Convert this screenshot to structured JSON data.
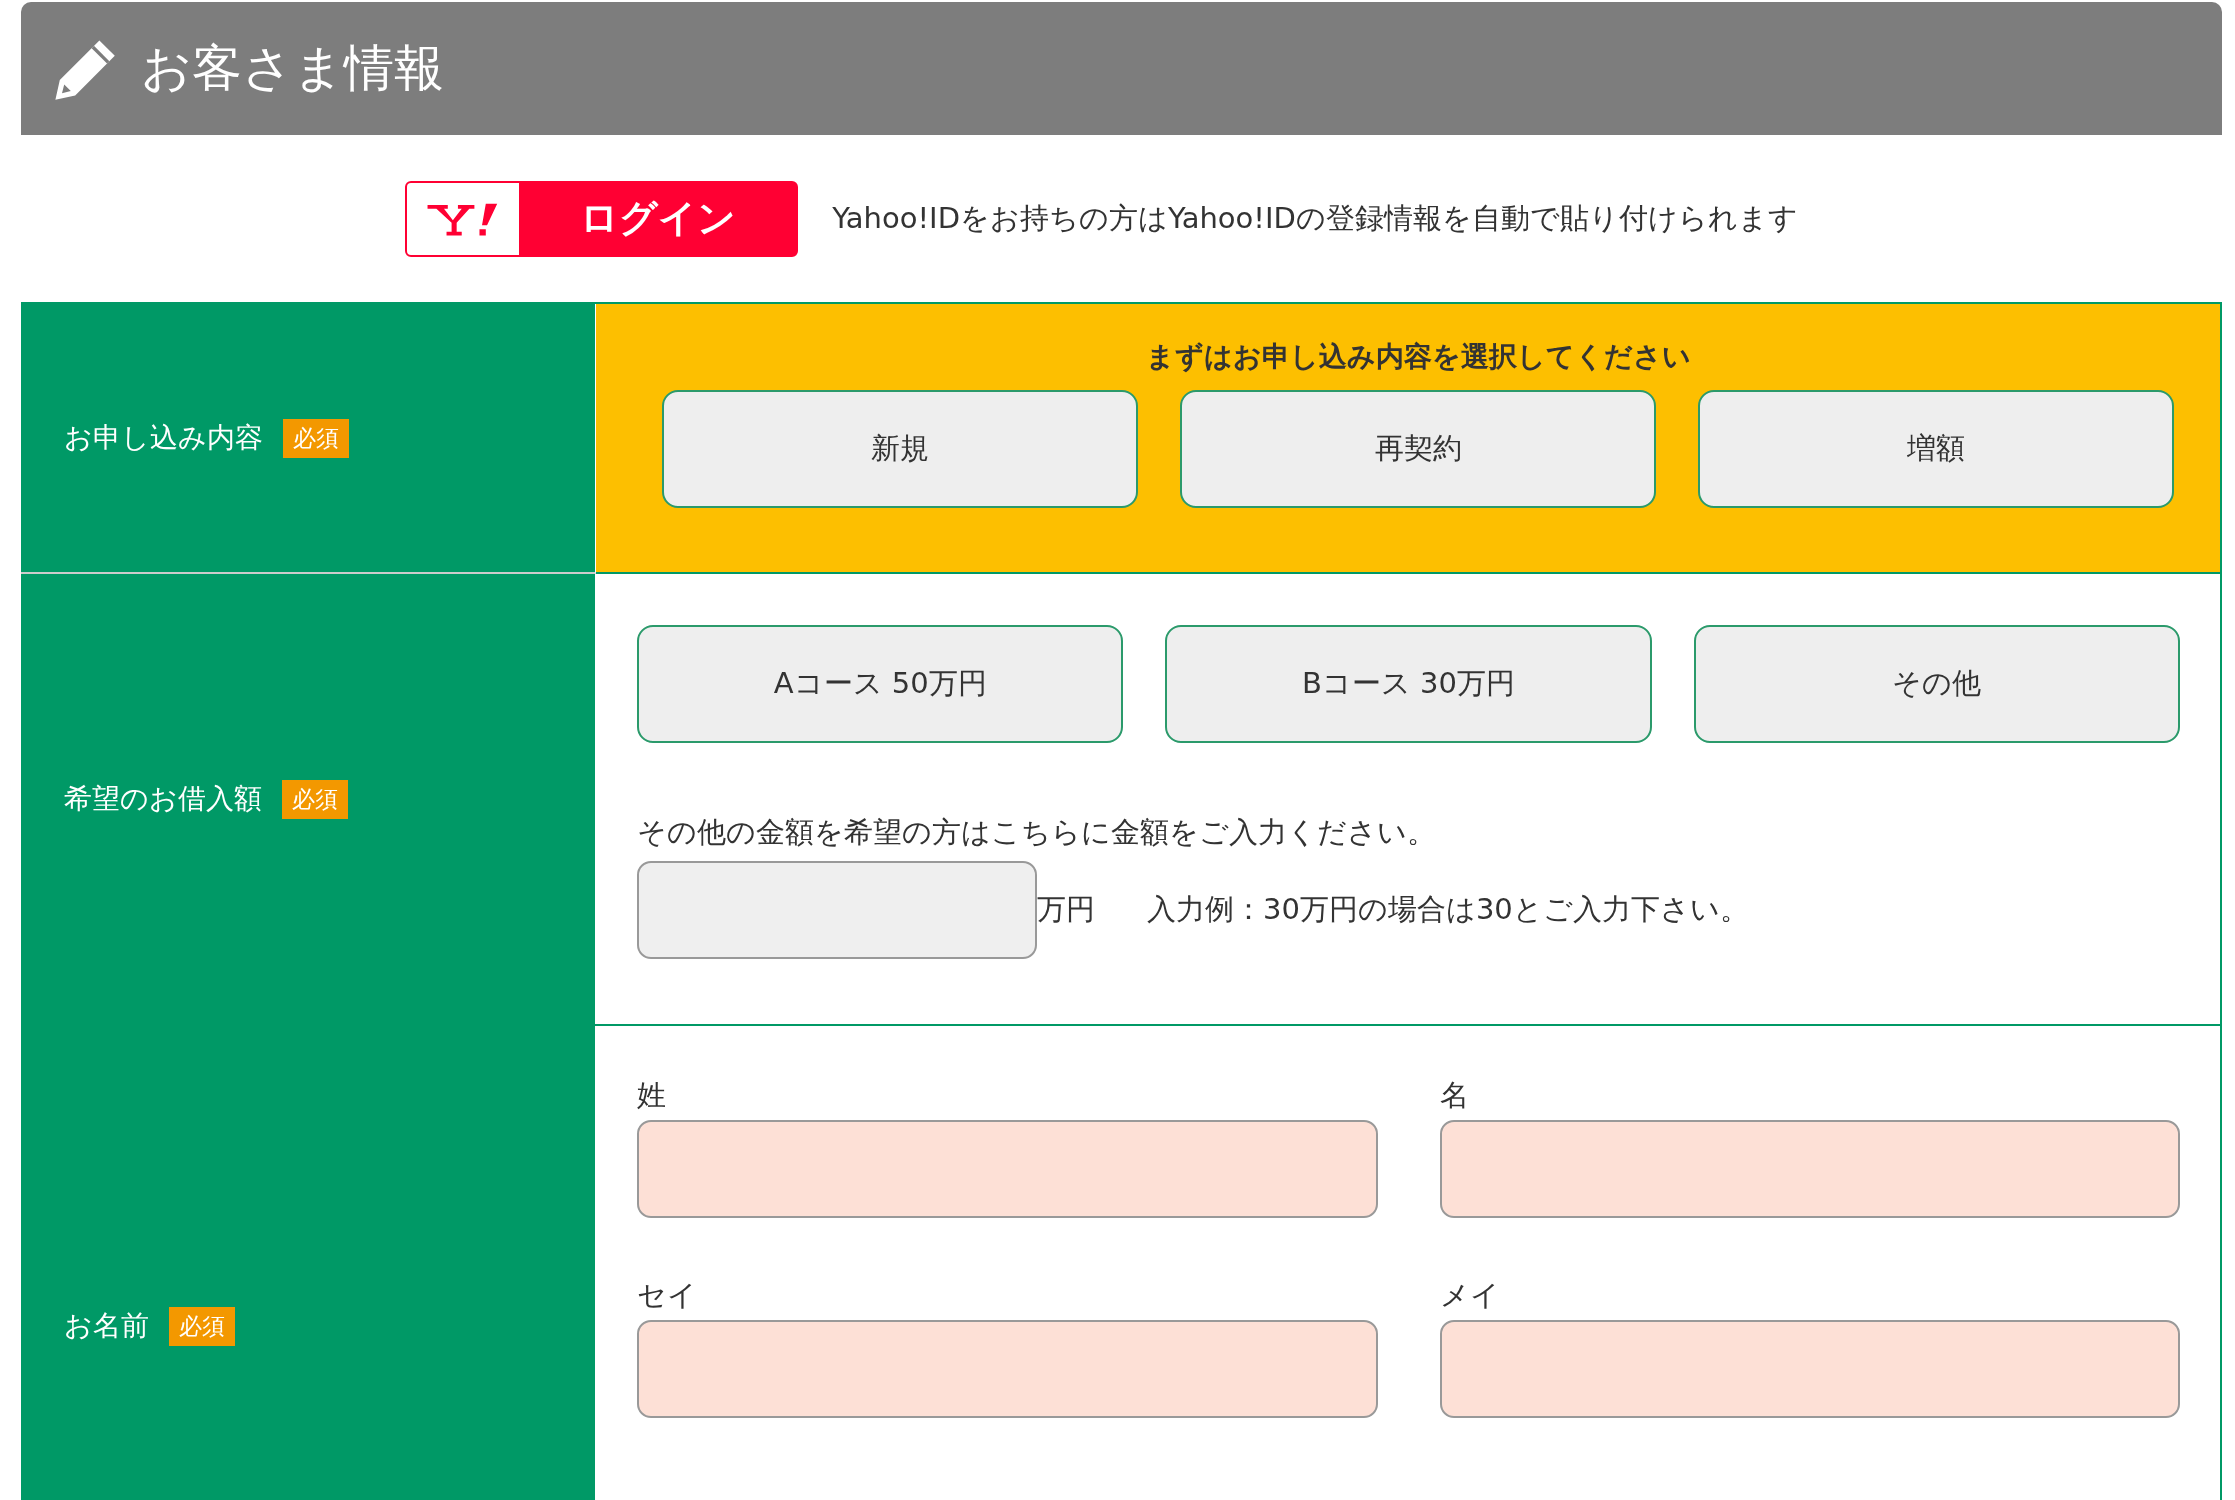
{
  "header": {
    "title": "お客さま情報"
  },
  "login": {
    "label": "ログイン",
    "note": "Yahoo!IDをお持ちの方はYahoo!IDの登録情報を自動で貼り付けられます"
  },
  "rows": [
    {
      "kind": "choice",
      "label": "お申し込み内容",
      "badge": "必須",
      "highlighted": true,
      "prompt": "まずはお申し込み内容を選択してください",
      "options": [
        {
          "label": "新規",
          "selected": false
        },
        {
          "label": "再契約",
          "selected": false
        },
        {
          "label": "増額",
          "selected": false
        }
      ]
    },
    {
      "kind": "amount",
      "label": "希望のお借入額",
      "badge": "必須",
      "highlighted": false,
      "options": [
        {
          "label": "Aコース 50万円",
          "selected": false
        },
        {
          "label": "Bコース 30万円",
          "selected": false
        },
        {
          "label": "その他",
          "selected": false
        }
      ],
      "hint": "その他の金額を希望の方はこちらに金額をご入力ください。",
      "field": {
        "highlighted": false
      },
      "unit": "万円",
      "example": "入力例：30万円の場合は30とご入力下さい。"
    },
    {
      "kind": "name",
      "label": "お名前",
      "badge": "必須",
      "highlighted": false,
      "fields": [
        {
          "label": "姓",
          "highlighted": true
        },
        {
          "label": "名",
          "highlighted": true
        },
        {
          "label": "セイ",
          "highlighted": true
        },
        {
          "label": "メイ",
          "highlighted": true
        }
      ]
    }
  ]
}
